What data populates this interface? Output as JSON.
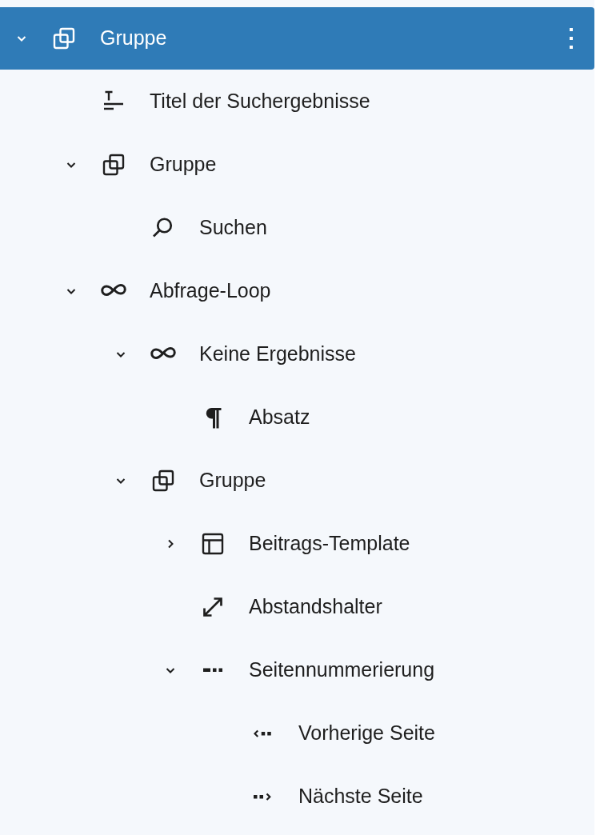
{
  "tree": [
    {
      "label": "Gruppe",
      "kind": "group",
      "expanded": true,
      "selected": true,
      "children": [
        {
          "label": "Titel der Suchergebnisse",
          "kind": "title",
          "selected": false
        },
        {
          "label": "Gruppe",
          "kind": "group",
          "expanded": true,
          "selected": false,
          "children": [
            {
              "label": "Suchen",
              "kind": "search",
              "selected": false
            }
          ]
        },
        {
          "label": "Abfrage-Loop",
          "kind": "loop",
          "expanded": true,
          "selected": false,
          "children": [
            {
              "label": "Keine Ergebnisse",
              "kind": "loop",
              "expanded": true,
              "selected": false,
              "children": [
                {
                  "label": "Absatz",
                  "kind": "paragraph",
                  "selected": false
                }
              ]
            },
            {
              "label": "Gruppe",
              "kind": "group",
              "expanded": true,
              "selected": false,
              "children": [
                {
                  "label": "Beitrags-Template",
                  "kind": "template",
                  "expanded": false,
                  "selected": false
                },
                {
                  "label": "Abstandshalter",
                  "kind": "spacer",
                  "selected": false
                },
                {
                  "label": "Seitennummerierung",
                  "kind": "pagination",
                  "expanded": true,
                  "selected": false,
                  "children": [
                    {
                      "label": "Vorherige Seite",
                      "kind": "previous",
                      "selected": false
                    },
                    {
                      "label": "Nächste Seite",
                      "kind": "next",
                      "selected": false
                    }
                  ]
                }
              ]
            }
          ]
        }
      ]
    }
  ]
}
